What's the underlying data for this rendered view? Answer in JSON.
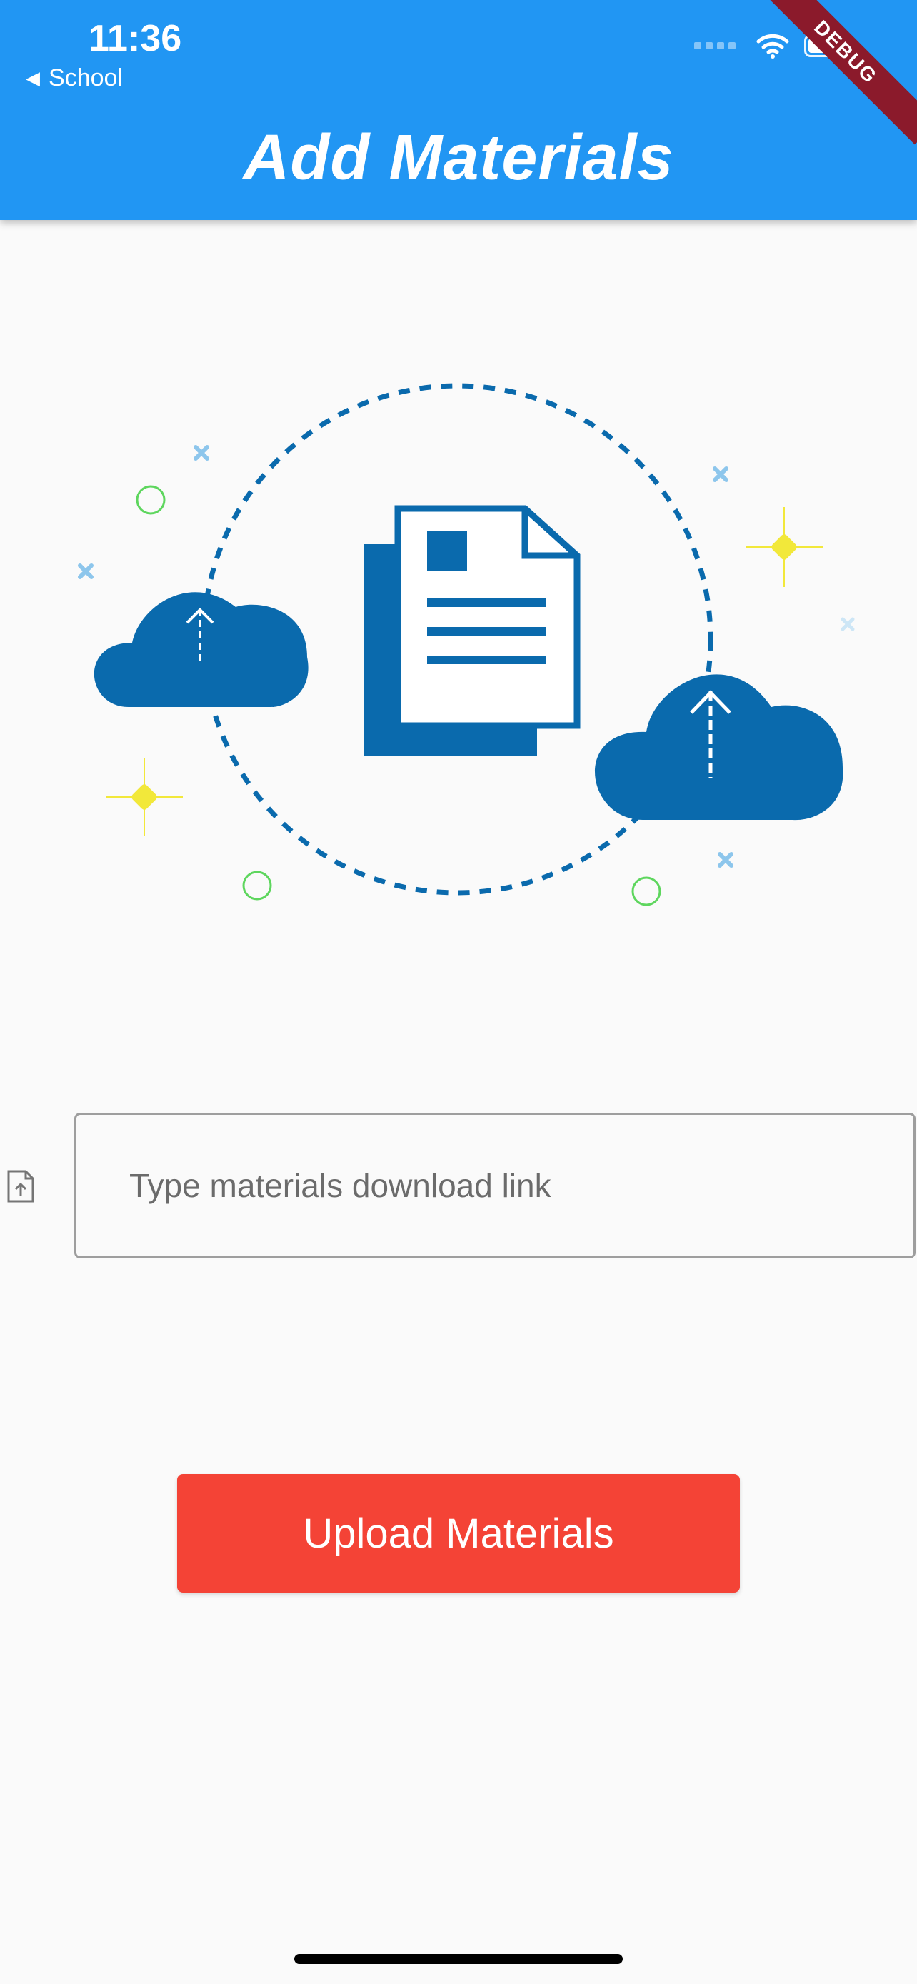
{
  "status_bar": {
    "time": "11:36",
    "back_label": "School"
  },
  "app_bar": {
    "title": "Add Materials",
    "debug_label": "DEBUG"
  },
  "form": {
    "link_placeholder": "Type materials download link",
    "link_value": ""
  },
  "actions": {
    "upload_label": "Upload Materials"
  },
  "colors": {
    "app_bar": "#2196f3",
    "upload_button": "#f44336",
    "illustration_blue": "#0a6aad"
  },
  "icons": [
    "wifi-icon",
    "battery-icon",
    "attach-file-icon",
    "cloud-upload-icon",
    "document-icon"
  ]
}
